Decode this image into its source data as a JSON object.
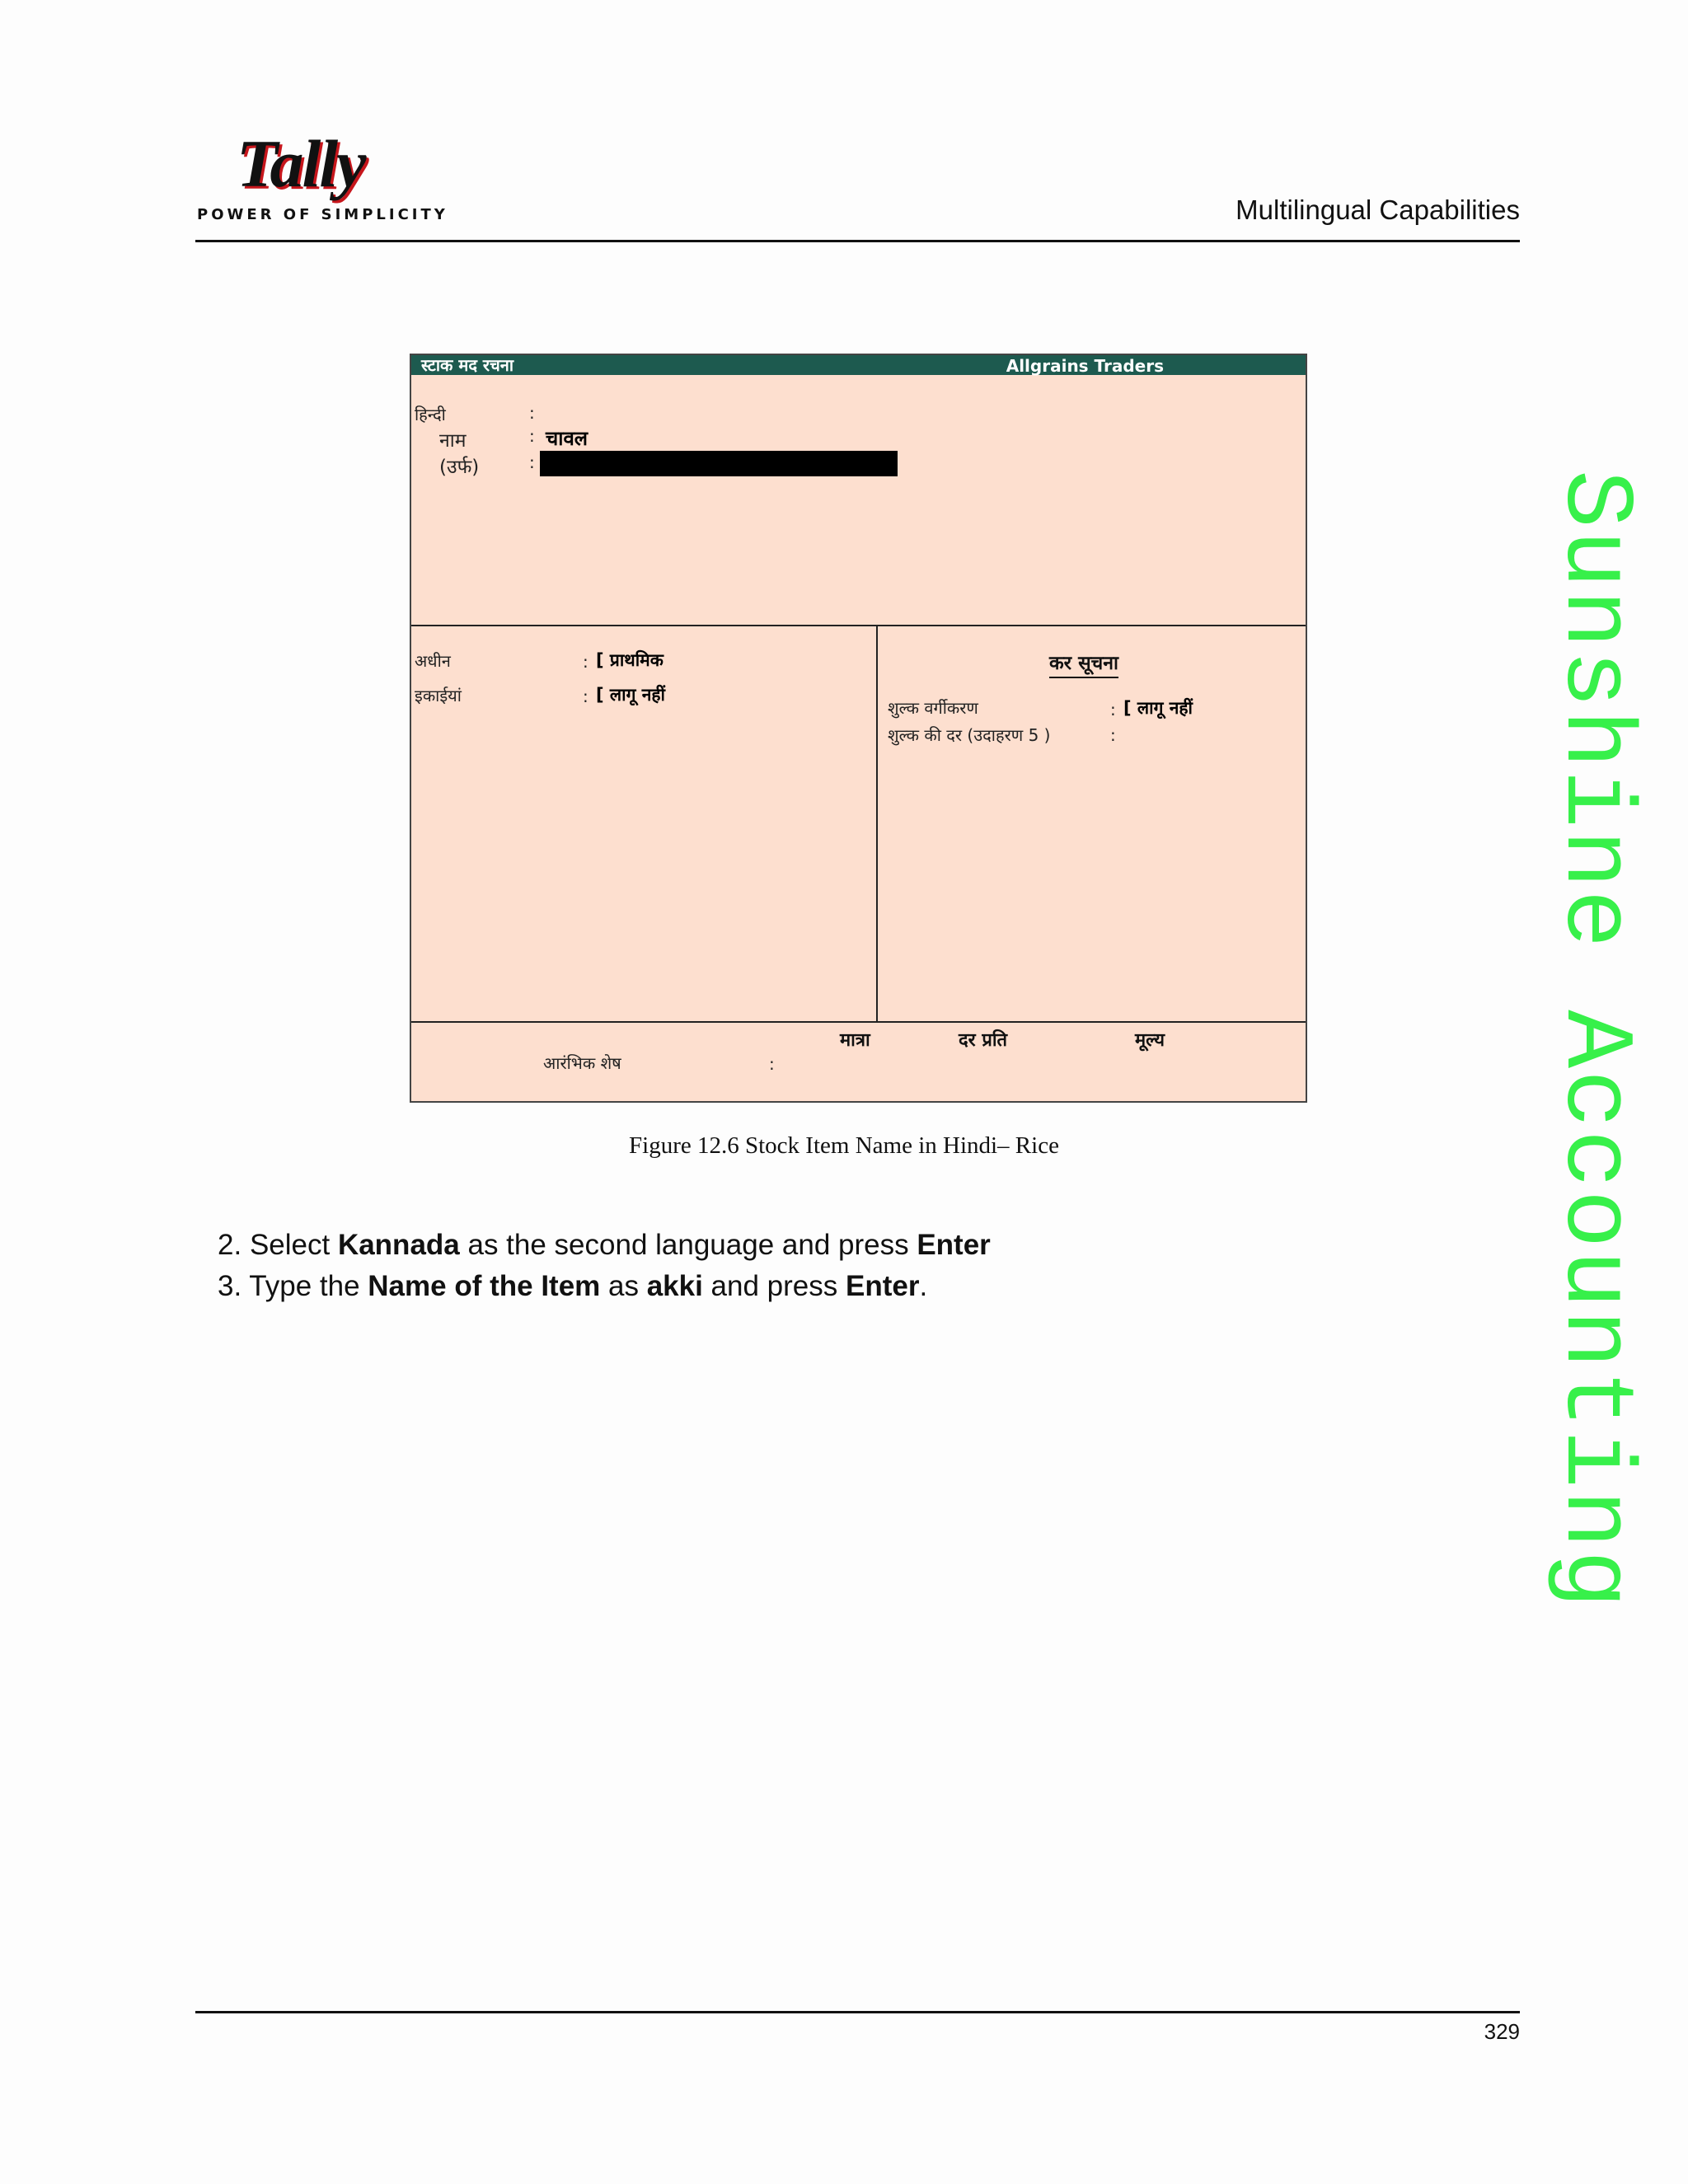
{
  "header": {
    "logo_text": "Tally",
    "logo_tagline": "POWER OF SIMPLICITY",
    "section_title": "Multilingual Capabilities"
  },
  "screenshot": {
    "screen_title": "स्टाक मद रचना",
    "company": "Allgrains Traders",
    "lang_label": "हिन्दी",
    "name_label": "नाम",
    "name_value": "चावल",
    "alias_label": "(उर्फ)",
    "under_label": "अधीन",
    "under_value": "[ प्राथमिक",
    "units_label": "इकाईयां",
    "units_value": "[ लागू नहीं",
    "tax_title": "कर सूचना",
    "duty_class_label": "शुल्क वर्गीकरण",
    "duty_class_value": "[ लागू नहीं",
    "duty_rate_label": "शुल्क की दर (उदाहरण 5 )",
    "col_qty": "मात्रा",
    "col_rate": "दर प्रति",
    "col_value": "मूल्य",
    "opening_label": "आरंभिक शेष",
    "colon": ":"
  },
  "caption": "Figure 12.6  Stock Item Name in Hindi– Rice",
  "steps": {
    "s2_num": "2.",
    "s2_a": "Select ",
    "s2_b": "Kannada",
    "s2_c": " as the second language and press ",
    "s2_d": "Enter",
    "s3_num": "3.",
    "s3_a": "Type the ",
    "s3_b": "Name of the Item",
    "s3_c": " as ",
    "s3_d": "akki",
    "s3_e": " and press ",
    "s3_f": "Enter",
    "s3_g": "."
  },
  "watermark": "Sunshine Accounting",
  "footer": {
    "page_number": "329"
  }
}
